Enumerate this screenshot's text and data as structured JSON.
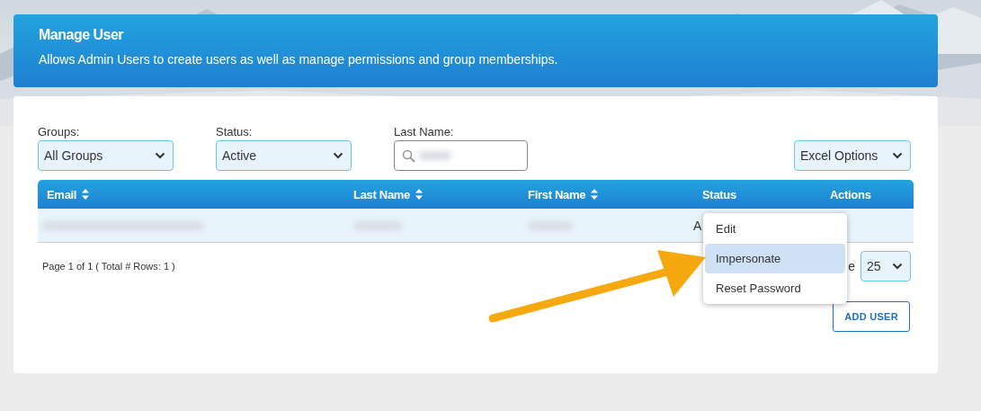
{
  "header": {
    "title": "Manage User",
    "description": "Allows Admin Users to create users as well as manage permissions and group memberships."
  },
  "filters": [
    {
      "label": "Groups:",
      "kind": "select",
      "value": "All Groups"
    },
    {
      "label": "Status:",
      "kind": "select",
      "value": "Active"
    },
    {
      "label": "Last Name:",
      "kind": "search",
      "redacted": true
    }
  ],
  "excel_options": "Excel Options",
  "table": {
    "columns": [
      {
        "label": "Email",
        "sortable": true
      },
      {
        "label": "Last Name",
        "sortable": true
      },
      {
        "label": "First Name",
        "sortable": true
      },
      {
        "label": "Status",
        "sortable": false
      },
      {
        "label": "Actions",
        "sortable": false
      }
    ],
    "rows": [
      {
        "cells": [
          {
            "redacted": true
          },
          {
            "redacted": true
          },
          {
            "redacted": true
          },
          {
            "text": "A"
          }
        ]
      }
    ]
  },
  "pagination": {
    "summary": "Page 1 of 1 ( Total # Rows: 1 )",
    "page_size_label": "e",
    "page_size": "25"
  },
  "add_user": "ADD USER",
  "context_menu": {
    "items": [
      {
        "label": "Edit",
        "selected": false
      },
      {
        "label": "Impersonate",
        "selected": true
      },
      {
        "label": "Reset Password",
        "selected": false
      }
    ]
  }
}
